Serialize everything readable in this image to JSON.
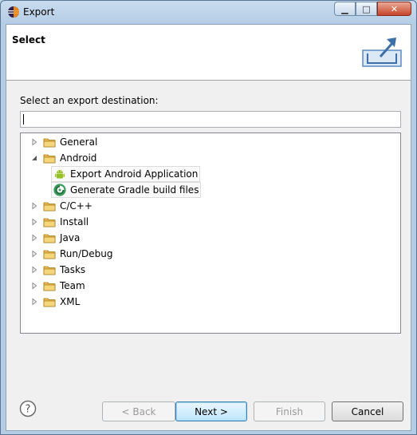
{
  "window": {
    "title": "Export",
    "minimize_glyph": "▁",
    "maximize_glyph": "□",
    "close_glyph": "✕"
  },
  "header": {
    "title": "Select",
    "graphic_icon": "export-wizard-icon"
  },
  "main": {
    "prompt": "Select an export destination:",
    "filter": {
      "value": "",
      "placeholder": ""
    },
    "tree": [
      {
        "label": "General",
        "type": "folder",
        "expanded": false
      },
      {
        "label": "Android",
        "type": "folder",
        "expanded": true,
        "children": [
          {
            "label": "Export Android Application",
            "icon": "android-icon"
          },
          {
            "label": "Generate Gradle build files",
            "icon": "gradle-icon"
          }
        ]
      },
      {
        "label": "C/C++",
        "type": "folder",
        "expanded": false
      },
      {
        "label": "Install",
        "type": "folder",
        "expanded": false
      },
      {
        "label": "Java",
        "type": "folder",
        "expanded": false
      },
      {
        "label": "Run/Debug",
        "type": "folder",
        "expanded": false
      },
      {
        "label": "Tasks",
        "type": "folder",
        "expanded": false
      },
      {
        "label": "Team",
        "type": "folder",
        "expanded": false
      },
      {
        "label": "XML",
        "type": "folder",
        "expanded": false
      }
    ]
  },
  "footer": {
    "help_glyph": "?",
    "back_label": "< Back",
    "next_label": "Next >",
    "finish_label": "Finish",
    "cancel_label": "Cancel"
  },
  "colors": {
    "folder": "#e8b84a",
    "android": "#97c024",
    "gradle": "#3a9c5a",
    "accent": "#3c7fb1"
  }
}
